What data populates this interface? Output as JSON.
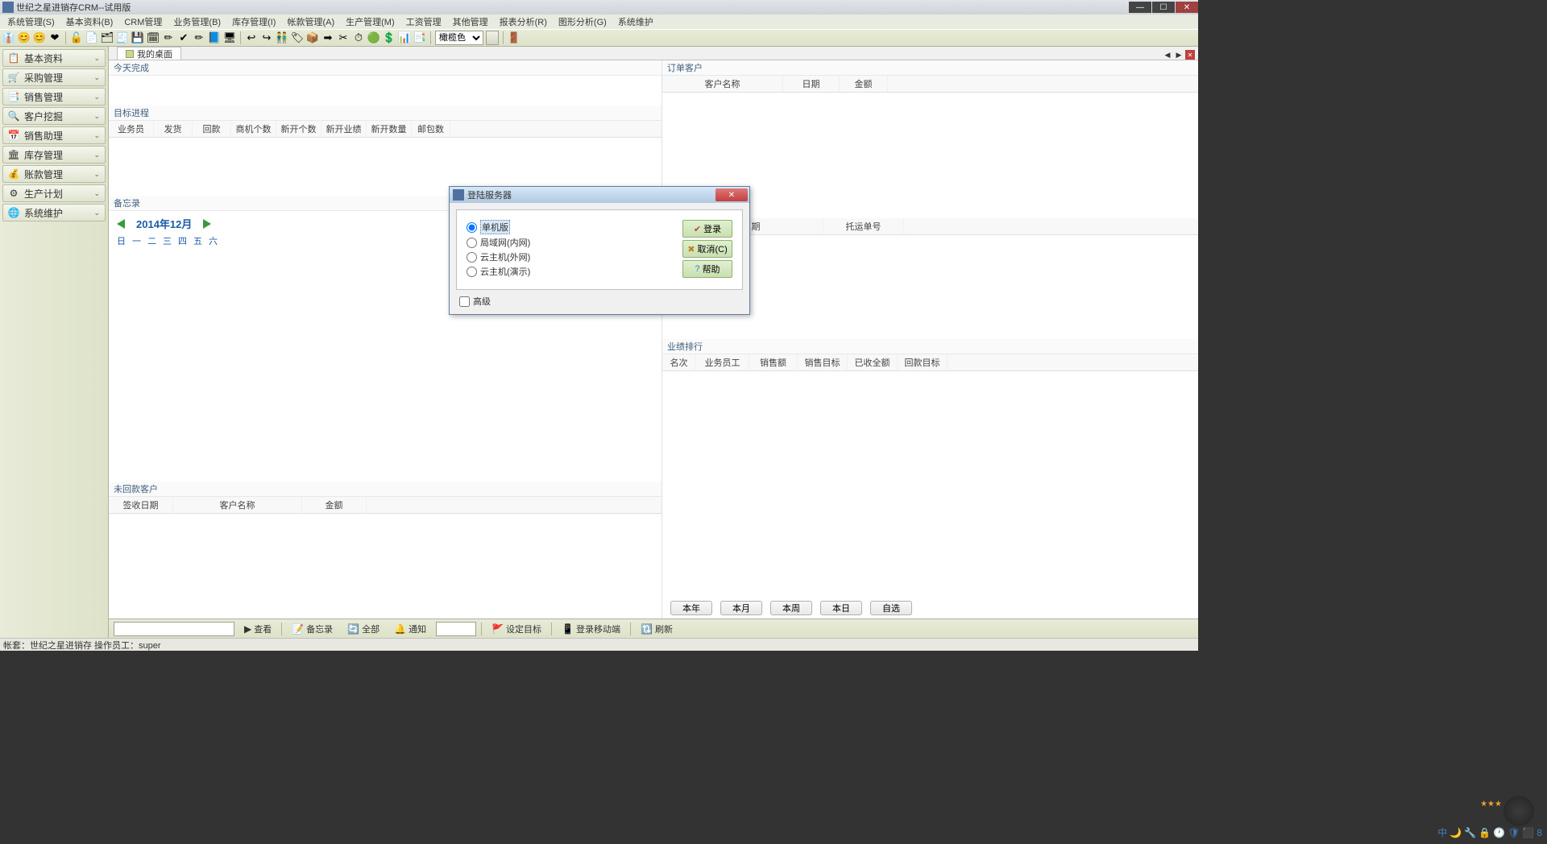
{
  "title": "世纪之星进销存CRM--试用版",
  "window_controls": {
    "min": "—",
    "max": "☐",
    "close": "✕"
  },
  "menu": [
    "系统管理(S)",
    "基本资料(B)",
    "CRM管理",
    "业务管理(B)",
    "库存管理(I)",
    "帐款管理(A)",
    "生产管理(M)",
    "工资管理",
    "其他管理",
    "报表分析(R)",
    "图形分析(G)",
    "系统维护"
  ],
  "toolbar_icons": [
    "👔",
    "😊",
    "😊",
    "❤",
    "🔓",
    "📄",
    "🗂",
    "🧾",
    "💾",
    "🗓",
    "✏",
    "✔",
    "✏",
    "📘",
    "🖥",
    "↩",
    "↪",
    "👬",
    "🏷",
    "📦",
    "➡",
    "✂",
    "⏱",
    "🟢",
    "💲",
    "📊",
    "📑"
  ],
  "toolbar_select": "橄榄色",
  "toolbar_exit": "🚪",
  "sidebar": {
    "items": [
      {
        "icon": "📋",
        "label": "基本资料"
      },
      {
        "icon": "🛒",
        "label": "采购管理"
      },
      {
        "icon": "📑",
        "label": "销售管理"
      },
      {
        "icon": "🔍",
        "label": "客户挖掘"
      },
      {
        "icon": "📅",
        "label": "销售助理"
      },
      {
        "icon": "🏛",
        "label": "库存管理"
      },
      {
        "icon": "💰",
        "label": "账款管理"
      },
      {
        "icon": "⚙",
        "label": "生产计划"
      },
      {
        "icon": "🌐",
        "label": "系统维护"
      }
    ],
    "chev": "⌄"
  },
  "tab": {
    "label": "我的桌面",
    "prev": "◀",
    "next": "▶",
    "close": "✕"
  },
  "panel0": {
    "title": "今天完成"
  },
  "panel1": {
    "title": "目标进程",
    "cols": [
      "业务员",
      "发货",
      "回款",
      "商机个数",
      "新开个数",
      "新开业绩",
      "新开数量",
      "邮包数"
    ]
  },
  "panel2": {
    "title": "备忘录"
  },
  "calendar": {
    "title": "2014年12月",
    "days": [
      "日",
      "一",
      "二",
      "三",
      "四",
      "五",
      "六"
    ]
  },
  "panel3": {
    "title": "未回款客户",
    "cols": [
      "签收日期",
      "客户名称",
      "金额"
    ]
  },
  "panel4": {
    "title": "订单客户",
    "cols": [
      "客户名称",
      "日期",
      "金额"
    ]
  },
  "panel5": {
    "cols": [
      "发货日期",
      "托运单号"
    ]
  },
  "panel6": {
    "title": "业绩排行",
    "cols": [
      "名次",
      "业务员工",
      "销售额",
      "销售目标",
      "已收全额",
      "回款目标"
    ]
  },
  "range_buttons": [
    "本年",
    "本月",
    "本周",
    "本日",
    "自选"
  ],
  "cmd": {
    "search": "查看",
    "memo": "备忘录",
    "all": "全部",
    "notify": "通知",
    "goal": "设定目标",
    "mobile": "登录移动端",
    "refresh": "刷新"
  },
  "status": "帐套：世纪之星进销存 操作员工：super",
  "dialog": {
    "title": "登陆服务器",
    "radios": [
      "单机版",
      "局域网(内网)",
      "云主机(外网)",
      "云主机(演示)"
    ],
    "selected": 0,
    "buttons": {
      "login": "登录",
      "cancel": "取消(C)",
      "help": "帮助"
    },
    "adv": "高级",
    "close": "✕"
  },
  "tray": {
    "text": "中",
    "icons": [
      "🌙",
      "🔧",
      "🔒",
      "🕐",
      "🛡",
      "⬛",
      "8"
    ]
  }
}
